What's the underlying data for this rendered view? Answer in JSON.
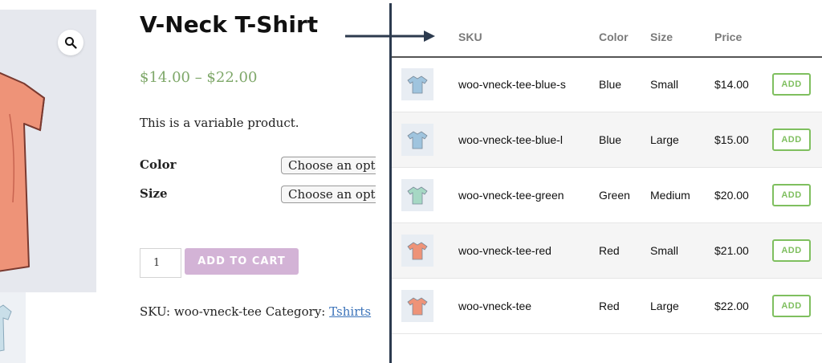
{
  "product": {
    "title": "V-Neck T-Shirt",
    "price_range": "$14.00 – $22.00",
    "description": "This is a variable product.",
    "color_label": "Color",
    "size_label": "Size",
    "select_placeholder": "Choose an option",
    "quantity": "1",
    "add_to_cart_label": "ADD TO CART",
    "sku_line": "SKU: woo-vneck-tee Category: ",
    "category_link": "Tshirts"
  },
  "table": {
    "headers": {
      "sku": "SKU",
      "color": "Color",
      "size": "Size",
      "price": "Price"
    },
    "rows": [
      {
        "sku": "woo-vneck-tee-blue-s",
        "color": "Blue",
        "size": "Small",
        "price": "$14.00",
        "button": "ADD",
        "shirt_color": "#9fc4de"
      },
      {
        "sku": "woo-vneck-tee-blue-l",
        "color": "Blue",
        "size": "Large",
        "price": "$15.00",
        "button": "ADD",
        "shirt_color": "#9fc4de"
      },
      {
        "sku": "woo-vneck-tee-green",
        "color": "Green",
        "size": "Medium",
        "price": "$20.00",
        "button": "ADD",
        "shirt_color": "#a6d8c4"
      },
      {
        "sku": "woo-vneck-tee-red",
        "color": "Red",
        "size": "Small",
        "price": "$21.00",
        "button": "ADD",
        "shirt_color": "#ee9378"
      },
      {
        "sku": "woo-vneck-tee",
        "color": "Red",
        "size": "Large",
        "price": "$22.00",
        "button": "ADD",
        "shirt_color": "#ee9378"
      }
    ]
  },
  "colors": {
    "price_green": "#7fa86a",
    "add_to_cart_bg": "#d3b3d6",
    "add_button_green": "#7fbf5f",
    "link_blue": "#3b73b9",
    "divider": "#2c3a4e",
    "main_shirt": "#ee9378"
  },
  "icons": {
    "zoom": "magnifier-icon",
    "arrow": "right-arrow-icon"
  }
}
